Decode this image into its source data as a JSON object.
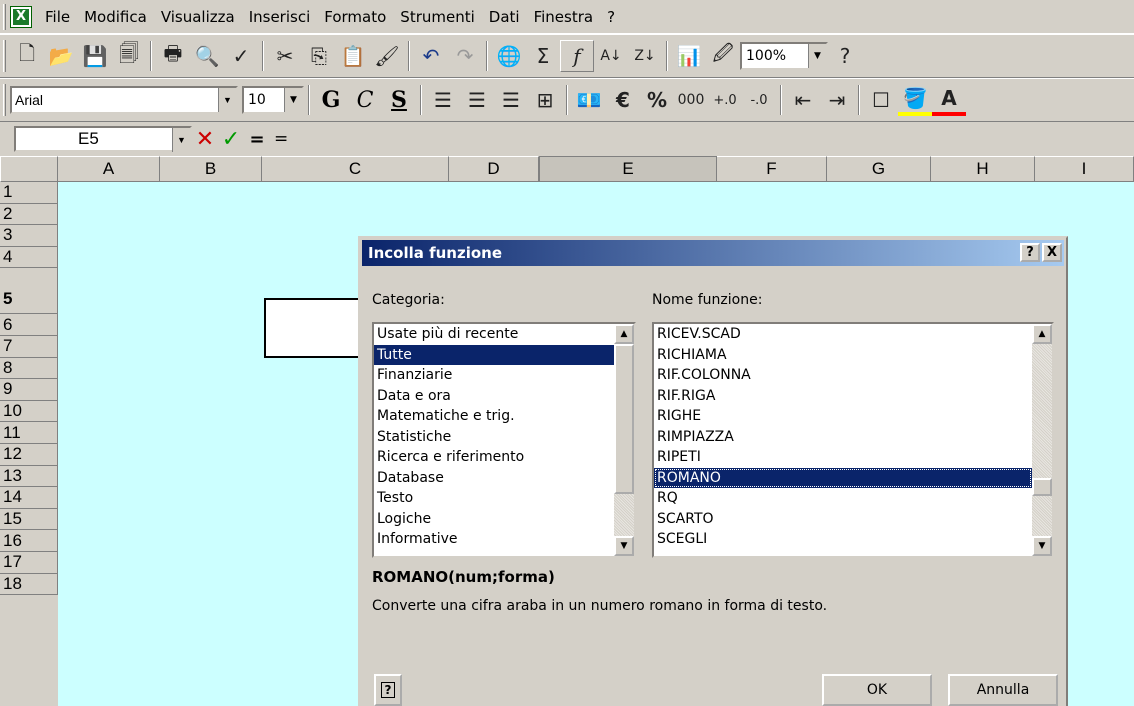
{
  "menu": [
    "File",
    "Modifica",
    "Visualizza",
    "Inserisci",
    "Formato",
    "Strumenti",
    "Dati",
    "Finestra",
    "?"
  ],
  "toolbar": {
    "zoom": "100%"
  },
  "format": {
    "font_name": "Arial",
    "font_size": "10",
    "bold": "G",
    "italic": "C",
    "underline": "S",
    "euro": "€",
    "percent": "%",
    "thousands": "000"
  },
  "formula_bar": {
    "cell_ref": "E5",
    "equals": "="
  },
  "grid": {
    "columns": [
      "A",
      "B",
      "C",
      "D",
      "E",
      "F",
      "G",
      "H",
      "I"
    ],
    "rows": [
      "1",
      "2",
      "3",
      "4",
      "5",
      "6",
      "7",
      "8",
      "9",
      "10",
      "11",
      "12",
      "13",
      "14",
      "15",
      "16",
      "17",
      "18"
    ]
  },
  "dialog": {
    "title": "Incolla funzione",
    "category_label": "Categoria:",
    "function_label": "Nome funzione:",
    "categories": [
      "Usate più di recente",
      "Tutte",
      "Finanziarie",
      "Data e ora",
      "Matematiche e trig.",
      "Statistiche",
      "Ricerca e riferimento",
      "Database",
      "Testo",
      "Logiche",
      "Informative"
    ],
    "functions": [
      "RICEV.SCAD",
      "RICHIAMA",
      "RIF.COLONNA",
      "RIF.RIGA",
      "RIGHE",
      "RIMPIAZZA",
      "RIPETI",
      "ROMANO",
      "RQ",
      "SCARTO",
      "SCEGLI"
    ],
    "syntax": "ROMANO(num;forma)",
    "description": "Converte una cifra araba in un numero romano in forma di testo.",
    "ok_label": "OK",
    "cancel_label": "Annulla",
    "help_glyph": "?",
    "close_glyph": "X"
  },
  "colors": {
    "sheet_bg": "#ccffff",
    "selection": "#0a246a",
    "face": "#d4d0c8"
  }
}
